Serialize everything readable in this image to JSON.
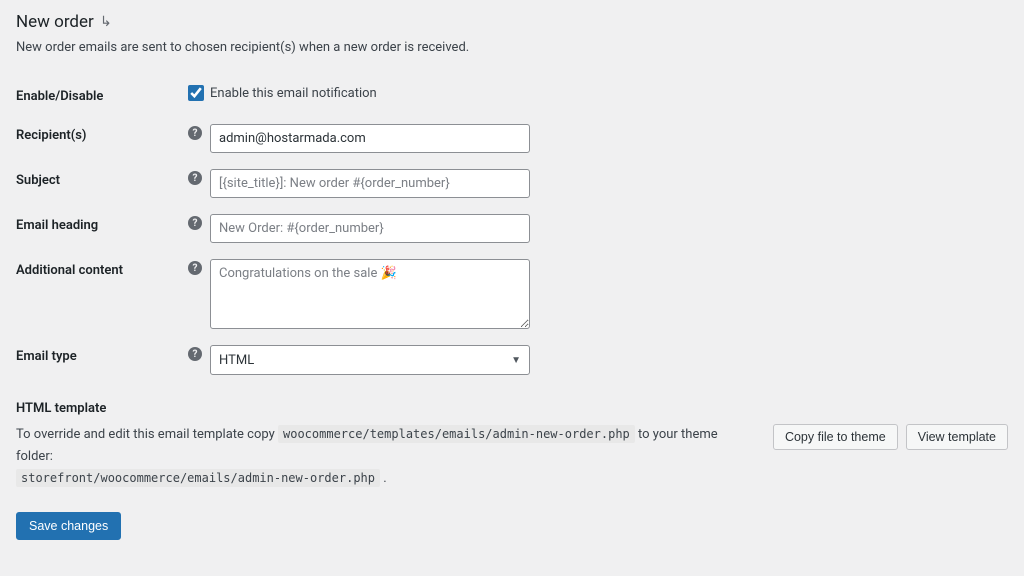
{
  "header": {
    "title": "New order",
    "description": "New order emails are sent to chosen recipient(s) when a new order is received."
  },
  "fields": {
    "enable_label": "Enable/Disable",
    "enable_checkbox_label": "Enable this email notification",
    "recipients_label": "Recipient(s)",
    "recipients_value": "admin@hostarmada.com",
    "subject_label": "Subject",
    "subject_placeholder": "[{site_title}]: New order #{order_number}",
    "heading_label": "Email heading",
    "heading_placeholder": "New Order: #{order_number}",
    "additional_label": "Additional content",
    "additional_placeholder": "Congratulations on the sale 🎉",
    "email_type_label": "Email type",
    "email_type_value": "HTML"
  },
  "template": {
    "section_label": "HTML template",
    "text_prefix": "To override and edit this email template copy",
    "code1": "woocommerce/templates/emails/admin-new-order.php",
    "text_mid": "to your theme folder:",
    "code2": "storefront/woocommerce/emails/admin-new-order.php",
    "copy_button": "Copy file to theme",
    "view_button": "View template"
  },
  "actions": {
    "save": "Save changes"
  }
}
